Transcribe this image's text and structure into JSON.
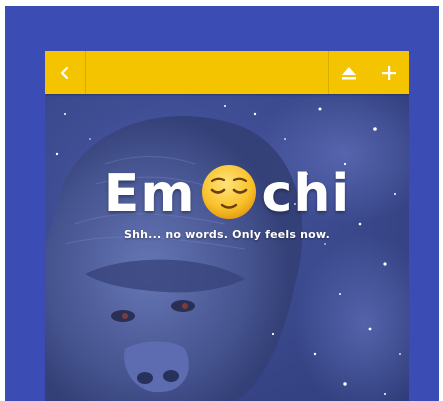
{
  "toolbar": {
    "back_icon": "chevron-left-icon",
    "eject_icon": "eject-icon",
    "add_icon": "plus-icon",
    "color": "#f4c400"
  },
  "hero": {
    "logo_left": "Em",
    "logo_emoji": "relieved-face-emoji",
    "logo_right": "chi",
    "tagline": "Shh... no words. Only feels now.",
    "background": "gorilla-space-illustration"
  },
  "colors": {
    "frame": "#3b4db4",
    "toolbar": "#f4c400",
    "text": "#ffffff"
  }
}
